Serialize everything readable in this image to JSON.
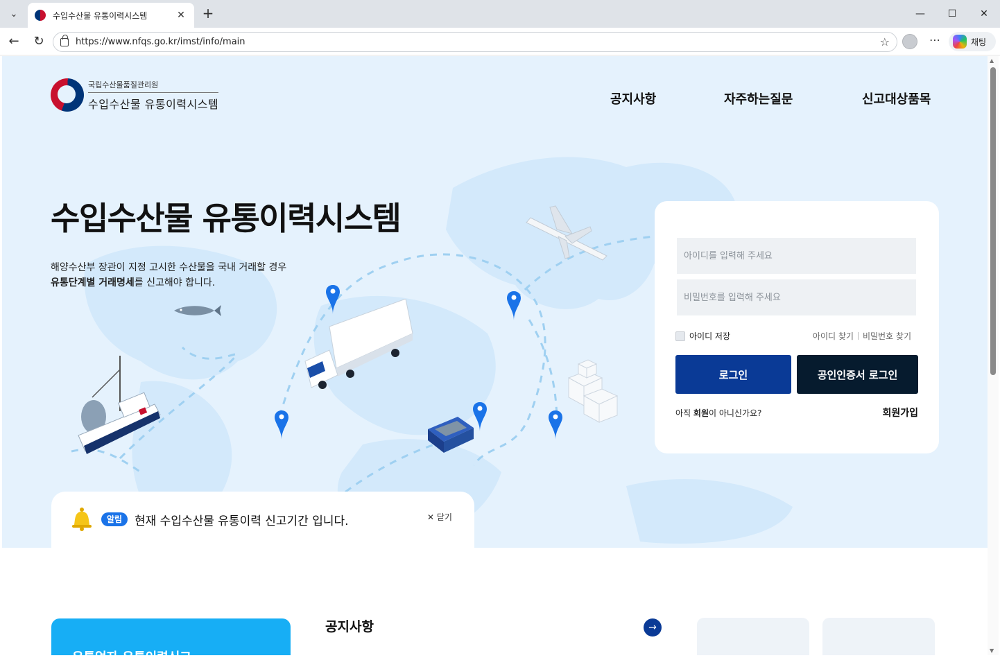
{
  "browser": {
    "tab_title": "수입수산물 유통이력시스템",
    "tab_close": "✕",
    "new_tab": "+",
    "url": "https://www.nfqs.go.kr/imst/info/main",
    "copilot_label": "채팅",
    "window_controls": [
      "—",
      "☐",
      "✕"
    ]
  },
  "site": {
    "org_name": "국립수산물품질관리원",
    "system_name": "수입수산물 유통이력시스템"
  },
  "nav": {
    "items": [
      "공지사항",
      "자주하는질문",
      "신고대상품목"
    ]
  },
  "hero": {
    "title_light": "수입수산물 ",
    "title_bold": "유통이력시스템",
    "desc_line1": "해양수산부 장관이 지정 고시한 수산물을 국내 거래할 경우",
    "desc_bold": "유통단계별 거래명세",
    "desc_line2_rest": "를 신고해야 합니다."
  },
  "login": {
    "id_placeholder": "아이디를 입력해 주세요",
    "pw_placeholder": "비밀번호를 입력해 주세요",
    "remember_label": "아이디 저장",
    "find_id": "아이디 찾기",
    "find_pw": "비밀번호 찾기",
    "login_button": "로그인",
    "cert_login_button": "공인인증서 로그인",
    "not_member_prefix": "아직 ",
    "not_member_bold": "회원",
    "not_member_suffix": "이 아니신가요?",
    "signup": "회원가입"
  },
  "alert": {
    "badge": "알림",
    "message": "현재 수입수산물 유통이력 신고기간 입니다.",
    "close": "✕ 닫기"
  },
  "below": {
    "card_title": "유통업자 유통이력신고",
    "notice_heading": "공지사항",
    "notice_more_icon": "→"
  },
  "colors": {
    "hero_bg": "#e5f2fd",
    "primary_blue": "#0a3a96",
    "dark_navy": "#061b2e",
    "accent_sky": "#17aef5",
    "alert_badge": "#1a73e8"
  }
}
